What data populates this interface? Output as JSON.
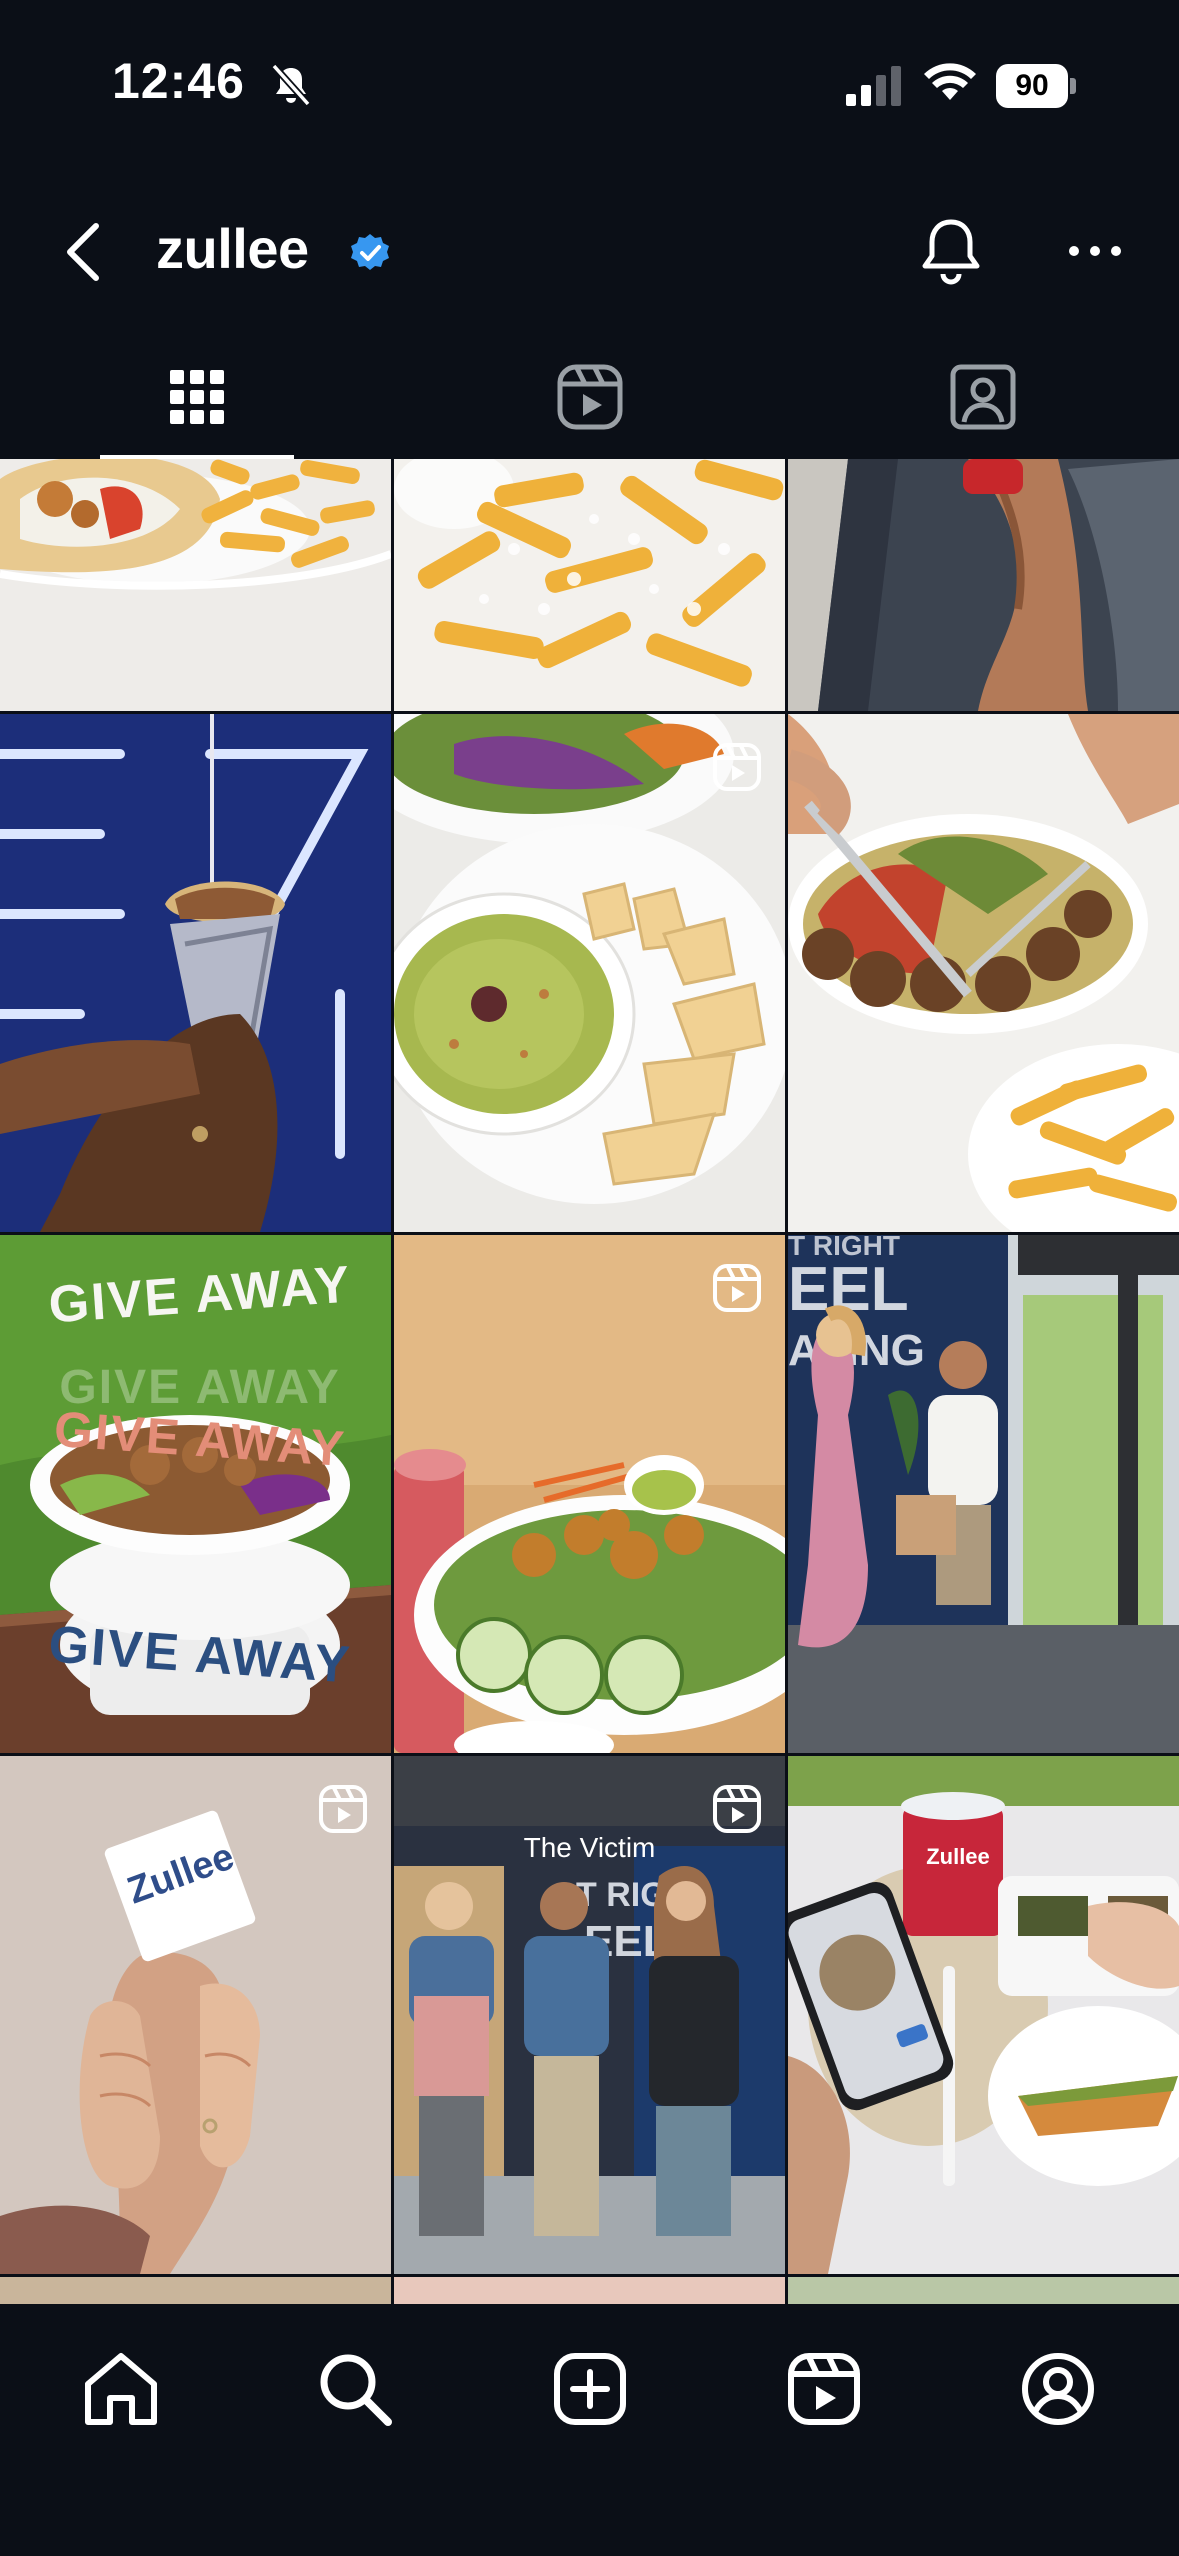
{
  "status_bar": {
    "time": "12:46",
    "battery": "90",
    "icons": [
      "bell-muted-icon",
      "signal-icon",
      "wifi-icon",
      "battery-icon"
    ]
  },
  "header": {
    "username": "zullee",
    "verified": true,
    "icons": [
      "back-chevron-icon",
      "verified-badge-icon",
      "notification-bell-icon",
      "more-icon"
    ]
  },
  "tabs": [
    {
      "name": "posts-grid",
      "icon": "grid-icon",
      "active": true
    },
    {
      "name": "reels",
      "icon": "reels-icon",
      "active": false
    },
    {
      "name": "tagged",
      "icon": "tagged-person-icon",
      "active": false
    }
  ],
  "posts": [
    {
      "id": "post-1",
      "subject": "gyro pita with fries",
      "is_reel": false
    },
    {
      "id": "post-2",
      "subject": "crinkle fries with feta",
      "is_reel": false
    },
    {
      "id": "post-3",
      "subject": "legs on street with drink",
      "is_reel": false
    },
    {
      "id": "post-4",
      "subject": "wrapped gyro in neon light",
      "is_reel": false
    },
    {
      "id": "post-5",
      "subject": "hummus with pita plate",
      "is_reel": true
    },
    {
      "id": "post-6",
      "subject": "falafel bowl with fries",
      "is_reel": false
    },
    {
      "id": "post-7",
      "subject": "giveaway bowl",
      "is_reel": false,
      "caption_lines": [
        "GIVE AWAY",
        "GIVE AWAY",
        "GIVE AWAY",
        "GIVE AWAY"
      ]
    },
    {
      "id": "post-8",
      "subject": "chicken salad bowl",
      "is_reel": true
    },
    {
      "id": "post-9",
      "subject": "couple at restaurant entrance",
      "is_reel": false
    },
    {
      "id": "post-10",
      "subject": "hands holding zullee card",
      "is_reel": true,
      "card_text": "Zullee"
    },
    {
      "id": "post-11",
      "subject": "three staff posing",
      "is_reel": true,
      "overlay_text": "The Victim"
    },
    {
      "id": "post-12",
      "subject": "phone and baklava on table",
      "is_reel": false,
      "cup_text": "Zullee"
    }
  ],
  "bottom_nav": [
    {
      "name": "home",
      "icon": "home-icon"
    },
    {
      "name": "search",
      "icon": "search-icon"
    },
    {
      "name": "create",
      "icon": "create-plus-icon"
    },
    {
      "name": "reels",
      "icon": "reels-icon"
    },
    {
      "name": "profile",
      "icon": "profile-icon"
    }
  ],
  "colors": {
    "background": "#0b0f17",
    "verified_blue": "#3797f0",
    "text": "#ffffff",
    "inactive_icon": "#9aa0a6"
  }
}
